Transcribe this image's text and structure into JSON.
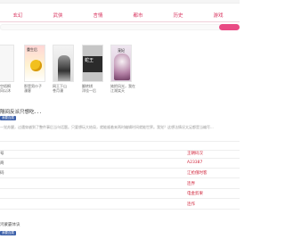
{
  "tabs": [
    {
      "label": "玄幻"
    },
    {
      "label": "武侠"
    },
    {
      "label": "言情"
    },
    {
      "label": "都市"
    },
    {
      "label": "历史"
    },
    {
      "label": "游戏"
    }
  ],
  "covers": [
    {
      "cover_text": "",
      "label_line1": "空梧桐",
      "label_line2": "风以沐"
    },
    {
      "cover_text": "重生后",
      "label_line1": "那是男仆子",
      "label_line2": "漫客"
    },
    {
      "cover_text": "",
      "label_line1": "网王下山",
      "label_line2": "苍月漫"
    },
    {
      "cover_text": "蛇王",
      "label_line1": "翻转棋",
      "label_line2": "洋佳一后"
    },
    {
      "cover_text": "宠妃",
      "label_line1": "她把风光，我在",
      "label_line2": "江湖笑天"
    }
  ],
  "section": {
    "title": "隔间反派只想吃．．．",
    "badge": "我要连载",
    "description": "一觉苏醒，过遇穿越到了整件事后当乌话题。只要想玩大结局，就能顺着来两时编辑时间就能世界。我觉？这想法情况太足都是当编写..."
  },
  "info_rows": [
    {
      "left": "号",
      "right": "王朝码汉"
    },
    {
      "left": "商",
      "right": "A23387"
    },
    {
      "left": "码",
      "right": "江抢俄时客"
    },
    {
      "left": "",
      "right": "连界"
    },
    {
      "left": "",
      "right": "电金剪果"
    },
    {
      "left": "",
      "right": "连作"
    }
  ],
  "bottom": {
    "title": "鸿蒙霸体诀",
    "badge": "我要连载"
  }
}
